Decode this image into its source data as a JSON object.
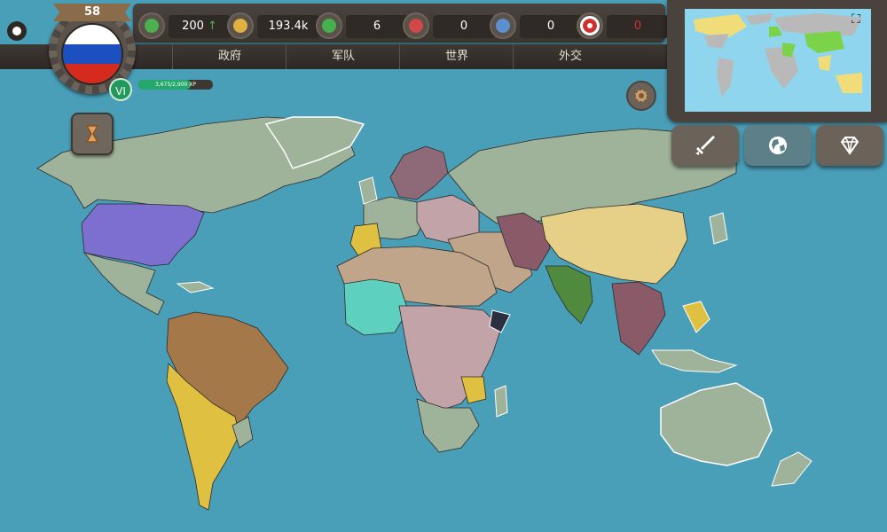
{
  "player": {
    "level": "58",
    "rank": "VI",
    "xp_text": "3,675/2,900 XP",
    "xp_fraction": 0.7
  },
  "resources": [
    {
      "name": "approval",
      "icon": "smiley-icon",
      "value": "200",
      "trend": "up",
      "color": "#4caf50"
    },
    {
      "name": "money",
      "icon": "coins-icon",
      "value": "193.4k",
      "color": "#e0b040"
    },
    {
      "name": "allies",
      "icon": "crown-green-icon",
      "value": "6",
      "color": "#46b04a"
    },
    {
      "name": "enemies",
      "icon": "crown-red-icon",
      "value": "0",
      "color": "#d04848"
    },
    {
      "name": "neutral",
      "icon": "crown-blue-icon",
      "value": "0",
      "color": "#5c8fd0"
    },
    {
      "name": "war",
      "icon": "flag-japan-icon",
      "value": "0",
      "color": "#d03030"
    }
  ],
  "tabs": [
    "政府",
    "军队",
    "世界",
    "外交"
  ],
  "actions": [
    {
      "name": "military",
      "icon": "sword-icon",
      "color": "#6b635a"
    },
    {
      "name": "world",
      "icon": "globe-icon",
      "color": "#5d7f88"
    },
    {
      "name": "premium",
      "icon": "diamond-icon",
      "color": "#6b635a"
    }
  ],
  "colors": {
    "ocean": "#4a9fb8",
    "neutral_land": "#9fb39a",
    "player": "#7c6fcf",
    "ui_dark": "#3b3530"
  },
  "minimap": {
    "ocean": "#8fd5ee",
    "land": "#b9b9b9",
    "owned": "#7bd34a",
    "ally": "#f0dd7a"
  }
}
